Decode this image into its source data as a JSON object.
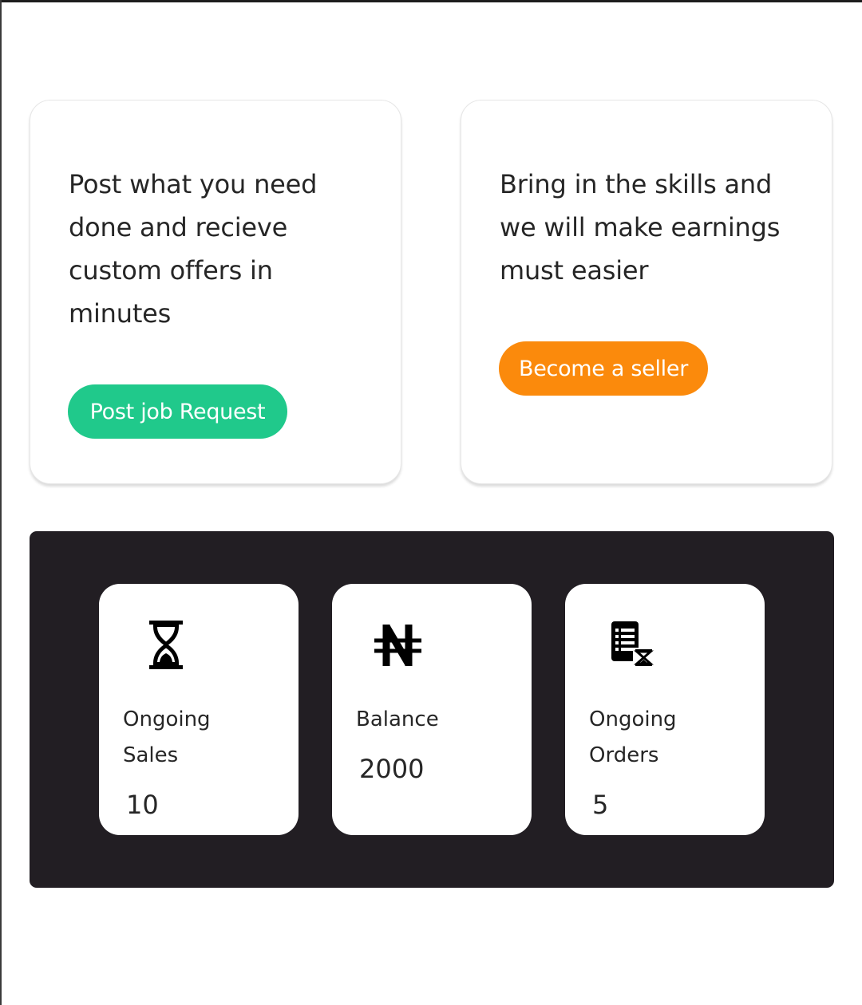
{
  "promo": {
    "buyer": {
      "text": "Post what you need done and recieve custom offers in minutes",
      "button_label": "Post job Request"
    },
    "seller": {
      "text": "Bring in the skills and we will make earnings must easier",
      "button_label": "Become a seller"
    }
  },
  "stats": {
    "sales": {
      "icon": "hourglass-icon",
      "label": "Ongoing Sales",
      "value": "10"
    },
    "balance": {
      "icon": "naira-icon",
      "label": "Balance",
      "value": "2000"
    },
    "orders": {
      "icon": "order-list-pending-icon",
      "label": "Ongoing Orders",
      "value": "5"
    }
  },
  "colors": {
    "green_button": "#20c98b",
    "orange_button": "#fb8a0c",
    "panel_background": "#221e23",
    "card_background": "#ffffff",
    "text": "#262626"
  }
}
